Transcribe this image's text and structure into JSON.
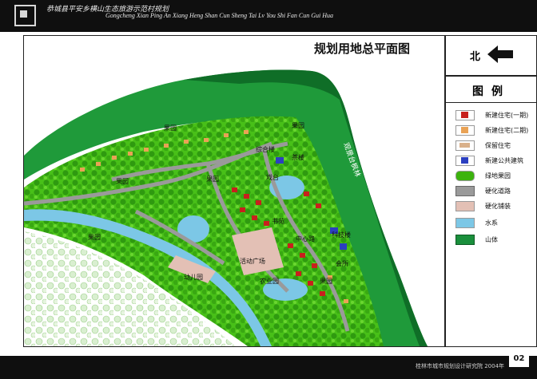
{
  "header": {
    "title_cn": "恭城县平安乡横山生态旅游示范村规划",
    "title_en": "Gongcheng Xian Ping An Xiang Heng Shan Cun Sheng Tai Lv You Shi Fan Cun Gui Hua"
  },
  "plan_title": "规划用地总平面图",
  "north_label": "北",
  "legend": {
    "title": "图例",
    "items": [
      {
        "label": "新建住宅(一期)",
        "icon": "new-house-phase1-swatch",
        "color": "#c8201d"
      },
      {
        "label": "新建住宅(二期)",
        "icon": "new-house-phase2-swatch",
        "color": "#e9a255"
      },
      {
        "label": "保留住宅",
        "icon": "retained-house-swatch",
        "color": "#d9b08a"
      },
      {
        "label": "新建公共建筑",
        "icon": "public-building-swatch",
        "color": "#2b3fc0"
      },
      {
        "label": "绿地果园",
        "icon": "orchard-swatch",
        "color": "#3cb30e"
      },
      {
        "label": "硬化道路",
        "icon": "road-swatch",
        "color": "#9a9a9a"
      },
      {
        "label": "硬化铺装",
        "icon": "paving-swatch",
        "color": "#e3c0b5"
      },
      {
        "label": "水系",
        "icon": "water-swatch",
        "color": "#7cc7e6"
      },
      {
        "label": "山体",
        "icon": "mountain-swatch",
        "color": "#1a8f3c"
      }
    ]
  },
  "map_labels": {
    "orchard_1": "果园",
    "orchard_2": "果园",
    "orchard_3": "果园",
    "orchard_4": "果园",
    "orchard_5": "果园",
    "orchard_6": "果园",
    "teahouse": "茶楼",
    "stage": "戏台",
    "building_a": "综合楼",
    "square": "活动广场",
    "tech_building": "科技楼",
    "hall": "会所",
    "reading": "书苑",
    "kindergarten": "幼儿园",
    "road_label": "中心路",
    "farm": "农业园",
    "ridge_label": "观景台枫林"
  },
  "footer": {
    "credit": "桂林市城市规划设计研究院    2004年",
    "page": "02"
  }
}
